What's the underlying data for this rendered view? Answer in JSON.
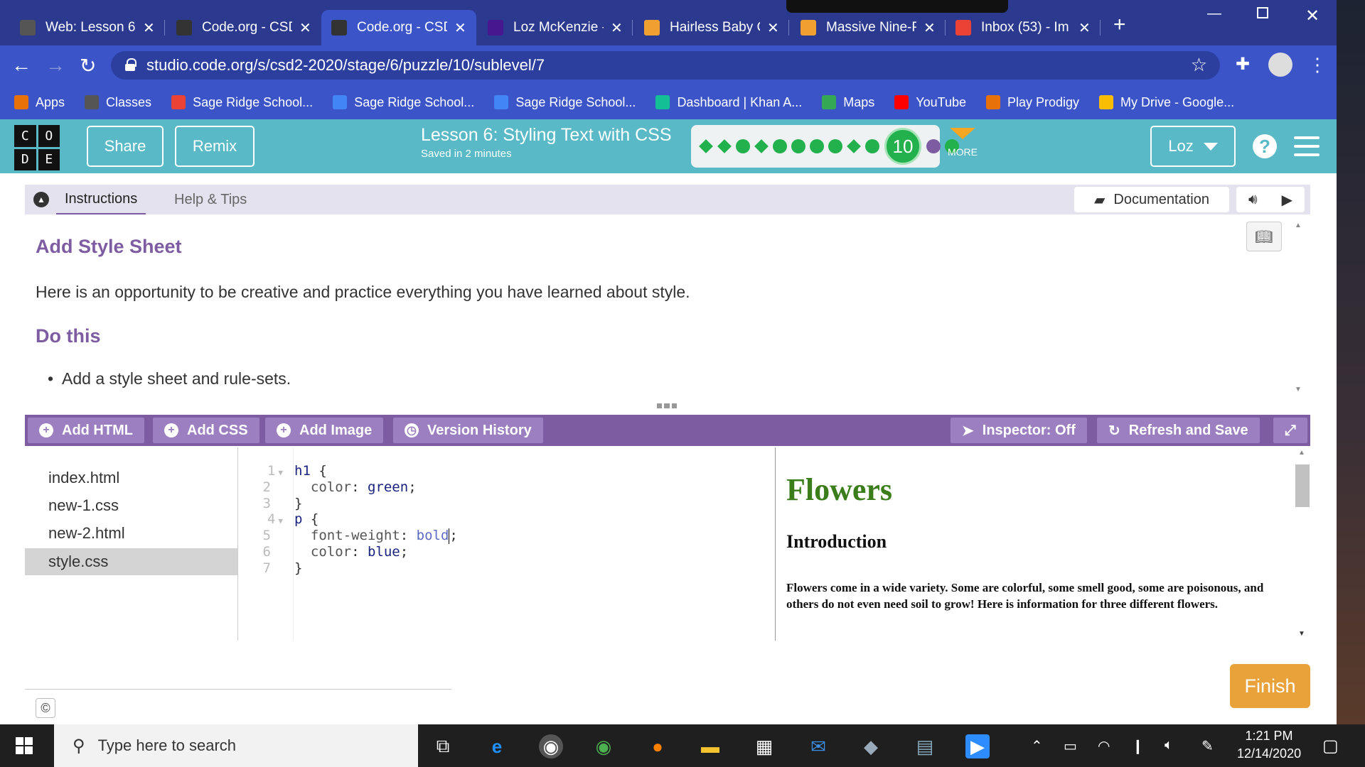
{
  "browser": {
    "tabs": [
      {
        "title": "Web: Lesson 6:",
        "icon": "classes-icon",
        "color": "#555555"
      },
      {
        "title": "Code.org - CSD",
        "icon": "codeorg-icon",
        "color": "#333333"
      },
      {
        "title": "Code.org - CSD",
        "icon": "codeorg-icon",
        "color": "#333333"
      },
      {
        "title": "Loz McKenzie -",
        "icon": "kahoot-icon",
        "color": "#46178f"
      },
      {
        "title": "Hairless Baby C",
        "icon": "home-icon",
        "color": "#f0a030"
      },
      {
        "title": "Massive Nine-P",
        "icon": "home-icon",
        "color": "#f0a030"
      },
      {
        "title": "Inbox (53) - Im",
        "icon": "gmail-icon",
        "color": "#ea4335"
      }
    ],
    "url": "studio.code.org/s/csd2-2020/stage/6/puzzle/10/sublevel/7",
    "bookmarks": [
      {
        "label": "Apps",
        "icon": "apps-grid-icon",
        "color": "#e8710a"
      },
      {
        "label": "Classes",
        "icon": "classes-icon",
        "color": "#555555"
      },
      {
        "label": "Sage Ridge School...",
        "icon": "gmail-icon",
        "color": "#ea4335"
      },
      {
        "label": "Sage Ridge School...",
        "icon": "classroom-icon",
        "color": "#4285f4"
      },
      {
        "label": "Sage Ridge School...",
        "icon": "calendar-icon",
        "color": "#4285f4"
      },
      {
        "label": "Dashboard | Khan A...",
        "icon": "khan-icon",
        "color": "#14bf96"
      },
      {
        "label": "Maps",
        "icon": "maps-icon",
        "color": "#34a853"
      },
      {
        "label": "YouTube",
        "icon": "youtube-icon",
        "color": "#ff0000"
      },
      {
        "label": "Play Prodigy",
        "icon": "prodigy-icon",
        "color": "#e8710a"
      },
      {
        "label": "My Drive - Google...",
        "icon": "drive-icon",
        "color": "#fbbc04"
      }
    ]
  },
  "codeorg": {
    "logo": [
      "C",
      "O",
      "D",
      "E"
    ],
    "share_label": "Share",
    "remix_label": "Remix",
    "lesson_title": "Lesson 6: Styling Text with CSS",
    "saved_text": "Saved in 2 minutes",
    "current_level": "10",
    "more_label": "MORE",
    "user_label": "Loz",
    "help_label": "?"
  },
  "instructions": {
    "tab_instructions": "Instructions",
    "tab_help": "Help & Tips",
    "documentation_label": "Documentation",
    "heading": "Add Style Sheet",
    "body": "Here is an opportunity to be creative and practice everything you have learned about style.",
    "do_this": "Do this",
    "bullet": "Add a style sheet and rule-sets."
  },
  "toolbar": {
    "add_html": "Add HTML",
    "add_css": "Add CSS",
    "add_image": "Add Image",
    "version_history": "Version History",
    "inspector": "Inspector: Off",
    "refresh": "Refresh and Save"
  },
  "files": [
    "index.html",
    "new-1.css",
    "new-2.html",
    "style.css"
  ],
  "selected_file": "style.css",
  "code_lines": [
    {
      "n": "1",
      "fold": true,
      "text": "h1 {"
    },
    {
      "n": "2",
      "fold": false,
      "text": "  color: green;"
    },
    {
      "n": "3",
      "fold": false,
      "text": "}"
    },
    {
      "n": "4",
      "fold": true,
      "text": "p {"
    },
    {
      "n": "5",
      "fold": false,
      "text": "  font-weight: bold;"
    },
    {
      "n": "6",
      "fold": false,
      "text": "  color: blue;"
    },
    {
      "n": "7",
      "fold": false,
      "text": "}"
    }
  ],
  "preview": {
    "h1": "Flowers",
    "h3": "Introduction",
    "paragraph": "Flowers come in a wide variety. Some are colorful, some smell good, some are poisonous, and others do not even need soil to grow! Here is information for three different flowers."
  },
  "finish_label": "Finish",
  "copyright": "©",
  "taskbar": {
    "search_placeholder": "Type here to search",
    "time": "1:21 PM",
    "date": "12/14/2020"
  }
}
